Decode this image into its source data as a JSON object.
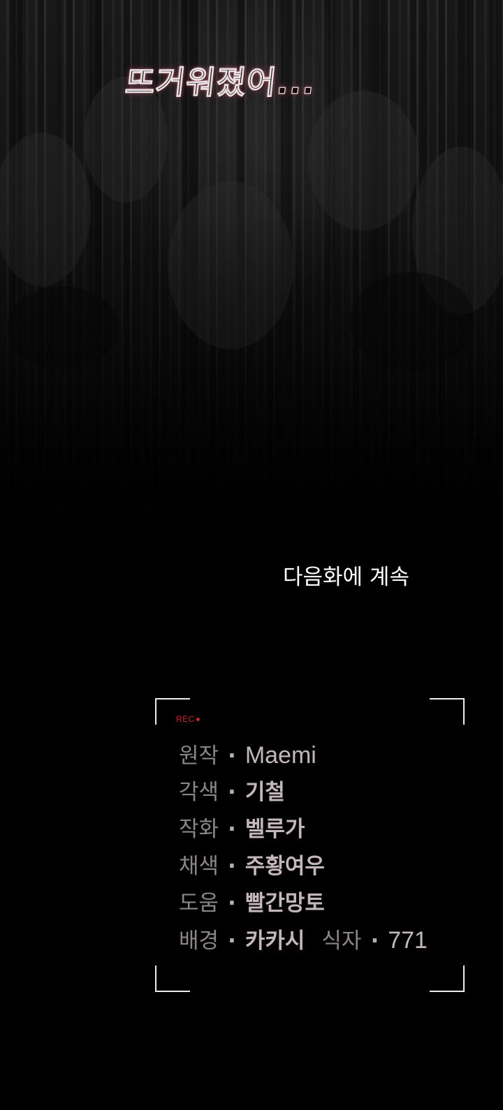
{
  "scene": {
    "exclamation": "뜨거워졌어...",
    "continued": "다음화에 계속"
  },
  "credits": {
    "rec_label": "REC",
    "separator": "·",
    "rows": [
      {
        "role": "원작",
        "name": "Maemi"
      },
      {
        "role": "각색",
        "name": "기철"
      },
      {
        "role": "작화",
        "name": "벨루가"
      },
      {
        "role": "채색",
        "name": "주황여우"
      },
      {
        "role": "도움",
        "name": "빨간망토"
      },
      {
        "role": "배경",
        "name": "카카시"
      }
    ],
    "extra": {
      "role": "식자",
      "name": "771"
    }
  },
  "colors": {
    "background": "#000000",
    "rec": "#c8262b",
    "frame": "#ececec",
    "role_text": "#8b8587",
    "name_text": "#c4b8be",
    "exclamation_glow": "#b8506e"
  }
}
